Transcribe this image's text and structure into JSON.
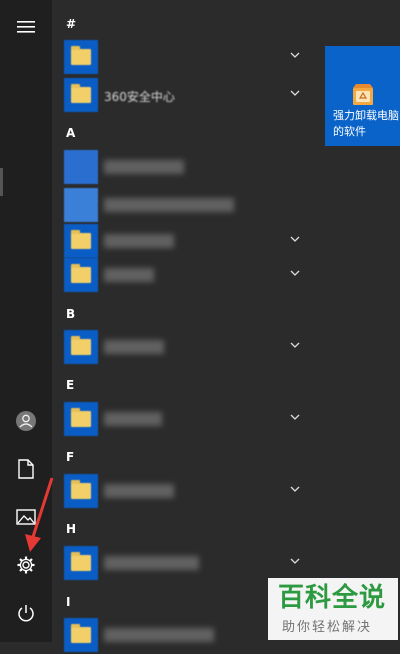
{
  "list": {
    "headers": [
      "#",
      "A",
      "B",
      "E",
      "F",
      "H",
      "I"
    ],
    "items": [
      {
        "name": "",
        "chevron": true
      },
      {
        "name": "360安全中心",
        "chevron": true
      },
      {
        "name": "",
        "chevron": false
      },
      {
        "name": "",
        "chevron": false
      },
      {
        "name": "",
        "chevron": true
      },
      {
        "name": "",
        "chevron": true
      },
      {
        "name": "",
        "chevron": true
      },
      {
        "name": "",
        "chevron": true
      },
      {
        "name": "",
        "chevron": true
      },
      {
        "name": "",
        "chevron": true
      },
      {
        "name": "",
        "chevron": false
      }
    ]
  },
  "tile": {
    "label": "强力卸载电脑的软件",
    "icon": "recycle-box-icon"
  },
  "rail": {
    "icons": [
      "hamburger-menu-icon",
      "user-avatar-icon",
      "document-icon",
      "pictures-icon",
      "settings-gear-icon",
      "power-icon"
    ]
  },
  "annotation": {
    "color": "#e53935",
    "icon": "red-arrow-icon"
  },
  "watermark": {
    "title": "百科全说",
    "subtitle": "助你轻松解决"
  },
  "colors": {
    "accent": "#0a63c8",
    "folder": "#f3cf6a",
    "background": "#2b2b2b",
    "watermark_green": "#2ea043"
  }
}
